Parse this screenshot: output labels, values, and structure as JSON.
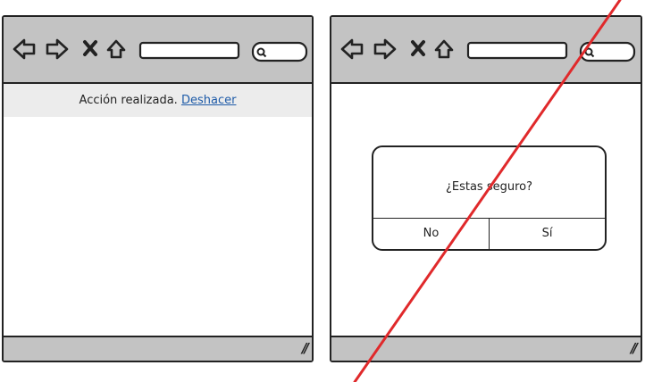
{
  "left_mockup": {
    "notification": {
      "message": "Acción realizada.",
      "undo_link": "Deshacer"
    }
  },
  "right_mockup": {
    "dialog": {
      "message": "¿Estas seguro?",
      "no_label": "No",
      "yes_label": "Sí"
    }
  },
  "toolbar_icons": [
    "back-arrow-icon",
    "forward-arrow-icon",
    "stop-x-icon",
    "home-icon",
    "search-icon"
  ],
  "colors": {
    "toolbar": "#c3c3c3",
    "notification_bg": "#ececec",
    "link": "#1e5ba8",
    "cross_out_line": "#e0292b",
    "stroke": "#222222"
  }
}
